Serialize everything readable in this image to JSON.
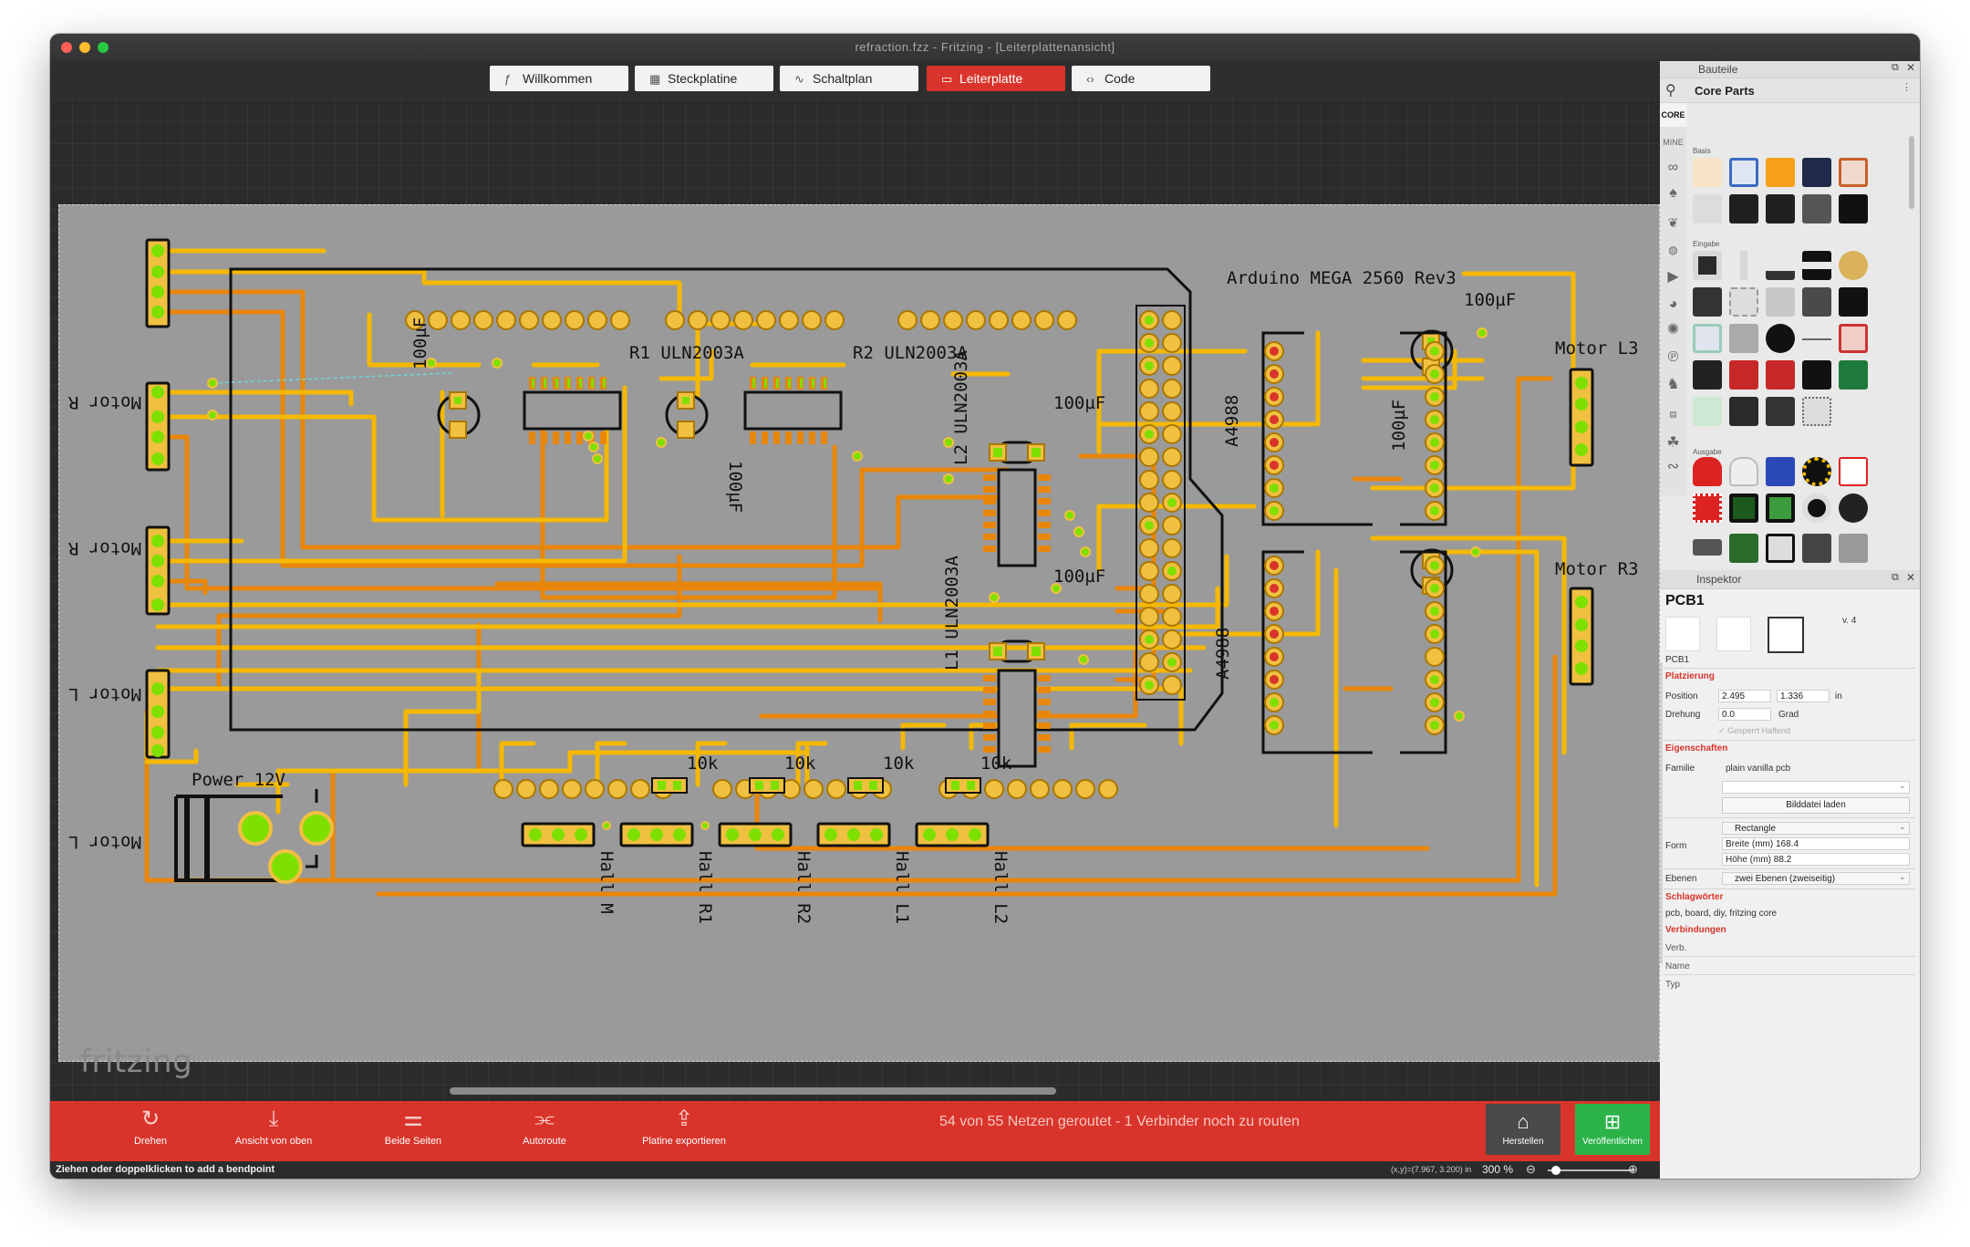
{
  "window": {
    "title": "refraction.fzz - Fritzing - [Leiterplattenansicht]"
  },
  "tabs": [
    {
      "label": "Willkommen",
      "icon": "fritzing-f-icon"
    },
    {
      "label": "Steckplatine",
      "icon": "breadboard-icon"
    },
    {
      "label": "Schaltplan",
      "icon": "schematic-icon"
    },
    {
      "label": "Leiterplatte",
      "icon": "pcb-icon",
      "active": true
    },
    {
      "label": "Code",
      "icon": "code-icon"
    }
  ],
  "canvas": {
    "logo": "fritzing",
    "board_labels": {
      "arduino": "Arduino MEGA 2560 Rev3",
      "r1": "R1 ULN2003A",
      "r2": "R2 ULN2003A",
      "l2": "L2 ULN2003A",
      "l1": "L1 ULN2003A",
      "a4988_top": "A4988",
      "a4988_bottom": "A4988",
      "motor_l3": "Motor L3",
      "motor_r3": "Motor R3",
      "motor_r_top": "Motor R",
      "motor_r_mid": "Motor R",
      "motor_l_mid": "Motor L",
      "motor_l_bottom": "Motor L",
      "power": "Power 12V",
      "cap_100uf": "100µF",
      "res_10k": "10k",
      "hall_m": "Hall M",
      "hall_r1": "Hall R1",
      "hall_r2": "Hall R2",
      "hall_l1": "Hall L1",
      "hall_l2": "Hall L2"
    },
    "colors": {
      "board": "#9a9a9a",
      "trace_top": "#f5b800",
      "trace_bottom": "#e8860a",
      "pad": "#f0c040",
      "via": "#7ee000",
      "silkscreen": "#000000"
    }
  },
  "toolbar": {
    "buttons": [
      {
        "label": "Drehen",
        "icon": "rotate-icon"
      },
      {
        "label": "Ansicht von oben",
        "icon": "view-from-above-icon"
      },
      {
        "label": "Beide Seiten",
        "icon": "both-sides-icon"
      },
      {
        "label": "Autoroute",
        "icon": "autoroute-icon"
      },
      {
        "label": "Platine exportieren",
        "icon": "export-icon"
      }
    ],
    "routing_status": "54 von 55 Netzen geroutet - 1 Verbinder noch zu routen",
    "herstellen": "Herstellen",
    "veroeffentlichen": "Veröffentlichen"
  },
  "statusbar": {
    "hint": "Ziehen oder doppelklicken to add a bendpoint",
    "coords": "(x,y)=(7.967, 3.200) in",
    "zoom": "300 %"
  },
  "parts_bin": {
    "title": "Bauteile",
    "search_title": "Core Parts",
    "bins": [
      "CORE",
      "MINE"
    ],
    "section_basis": "Basis",
    "section_eingabe": "Eingabe",
    "section_ausgabe": "Ausgabe"
  },
  "inspector": {
    "title": "Inspektor",
    "part_name": "PCB1",
    "version": "v. 4",
    "caption": "PCB1",
    "placement": {
      "section": "Platzierung",
      "position_label": "Position",
      "x": "2.495",
      "y": "1.336",
      "unit": "in",
      "rotation_label": "Drehung",
      "rotation": "0.0",
      "rotation_unit": "Grad",
      "locked": "Gesperrt",
      "sticky": "Haftend"
    },
    "properties": {
      "section": "Eigenschaften",
      "family_label": "Familie",
      "family": "plain vanilla pcb",
      "load_image": "Bilddatei laden",
      "shape_label": "Form",
      "shape": "Rectangle",
      "width": "Breite (mm) 168.4",
      "height": "Höhe (mm) 88.2",
      "layers_label": "Ebenen",
      "layers": "zwei Ebenen (zweiseitig)"
    },
    "tags": {
      "section": "Schlagwörter",
      "value": "pcb, board, diy, fritzing core"
    },
    "connections": {
      "section": "Verbindungen",
      "conn": "Verb.",
      "name": "Name",
      "type": "Typ"
    }
  }
}
